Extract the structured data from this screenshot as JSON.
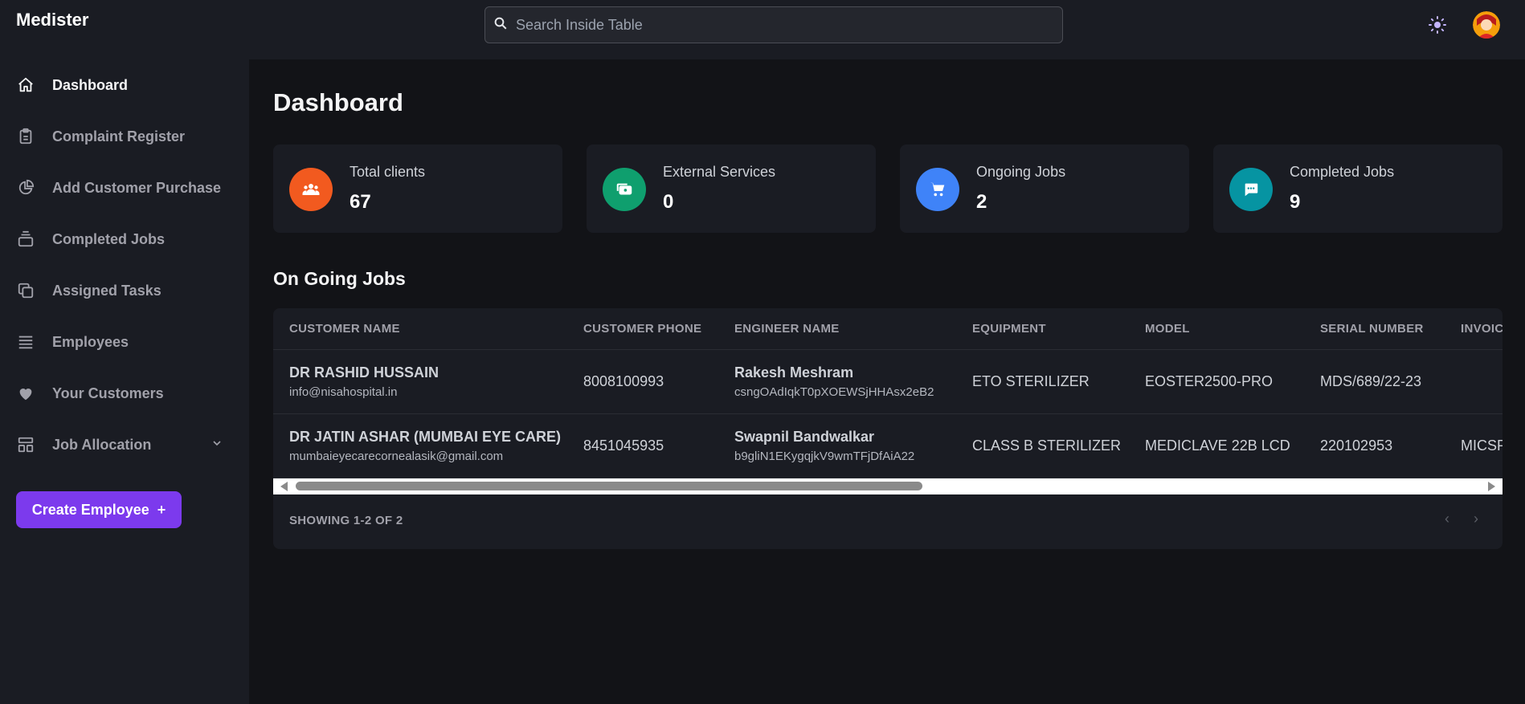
{
  "app": {
    "brand": "Medister"
  },
  "header": {
    "search_placeholder": "Search Inside Table",
    "theme_icon": "sun-icon",
    "avatar_icon": "user-avatar"
  },
  "sidebar": {
    "items": [
      {
        "label": "Dashboard",
        "icon": "home-icon",
        "active": true
      },
      {
        "label": "Complaint Register",
        "icon": "clipboard-icon"
      },
      {
        "label": "Add Customer Purchase",
        "icon": "pie-chart-icon"
      },
      {
        "label": "Completed Jobs",
        "icon": "inbox-stack-icon"
      },
      {
        "label": "Assigned Tasks",
        "icon": "copy-icon"
      },
      {
        "label": "Employees",
        "icon": "list-icon"
      },
      {
        "label": "Your Customers",
        "icon": "heart-icon"
      },
      {
        "label": "Job Allocation",
        "icon": "layout-icon",
        "has_submenu": true
      }
    ],
    "create_button": {
      "label": "Create Employee",
      "symbol": "+"
    }
  },
  "main": {
    "title": "Dashboard",
    "cards": [
      {
        "label": "Total clients",
        "value": "67",
        "icon": "users-icon",
        "color": "#f25a1f"
      },
      {
        "label": "External Services",
        "value": "0",
        "icon": "cash-icon",
        "color": "#0f9f6e"
      },
      {
        "label": "Ongoing Jobs",
        "value": "2",
        "icon": "cart-icon",
        "color": "#3f83f8"
      },
      {
        "label": "Completed Jobs",
        "value": "9",
        "icon": "chat-icon",
        "color": "#0694a2"
      }
    ],
    "section_title": "On Going Jobs",
    "table": {
      "headers": [
        "CUSTOMER NAME",
        "CUSTOMER PHONE",
        "ENGINEER NAME",
        "EQUIPMENT",
        "MODEL",
        "SERIAL NUMBER",
        "INVOIC"
      ],
      "rows": [
        {
          "customer_name": "DR RASHID HUSSAIN",
          "customer_email": "info@nisahospital.in",
          "phone": "8008100993",
          "engineer_name": "Rakesh Meshram",
          "engineer_id": "csngOAdIqkT0pXOEWSjHHAsx2eB2",
          "equipment": "ETO STERILIZER",
          "model": "EOSTER2500-PRO",
          "serial": "MDS/689/22-23",
          "invoice": ""
        },
        {
          "customer_name": "DR JATIN ASHAR (MUMBAI EYE CARE)",
          "customer_email": "mumbaieyecarecornealasik@gmail.com",
          "phone": "8451045935",
          "engineer_name": "Swapnil Bandwalkar",
          "engineer_id": "b9gliN1EKygqjkV9wmTFjDfAiA22",
          "equipment": "CLASS B STERILIZER",
          "model": "MEDICLAVE 22B LCD",
          "serial": "220102953",
          "invoice": "MICSP"
        }
      ],
      "showing": "SHOWING 1-2 OF 2",
      "prev_symbol": "‹",
      "next_symbol": "›"
    }
  }
}
